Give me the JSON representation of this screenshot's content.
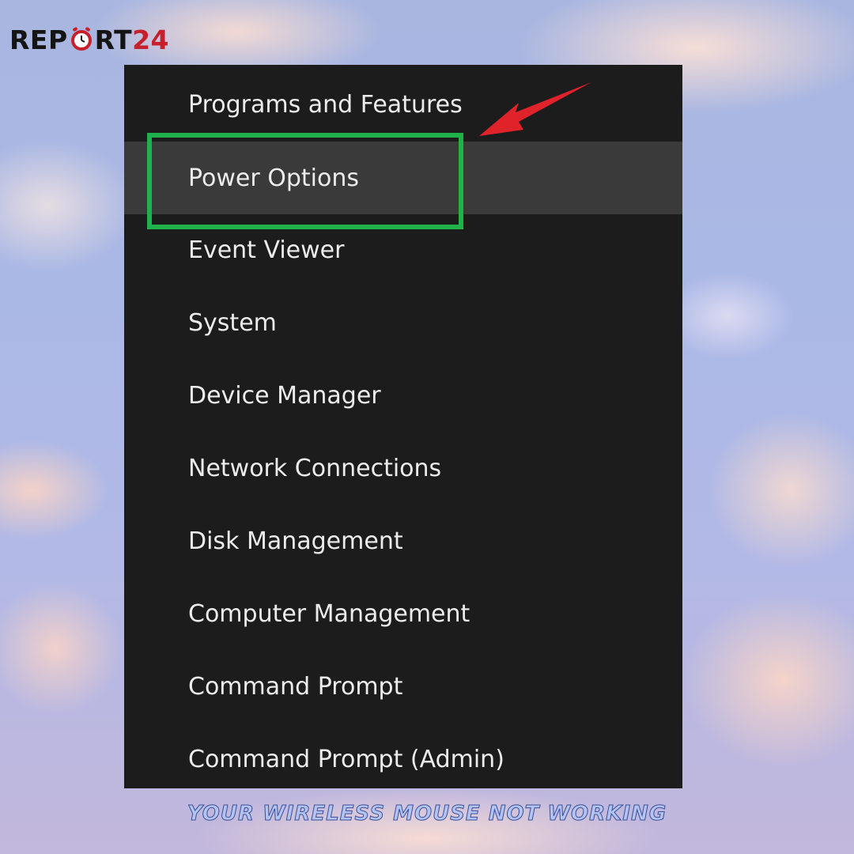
{
  "brand": {
    "logo_prefix": "REP",
    "logo_middle": "RT",
    "logo_suffix": "24",
    "logo_icon": "alarm-clock-icon",
    "colors": {
      "dark": "#141414",
      "red": "#c8202a"
    }
  },
  "context_menu": {
    "items": [
      {
        "label": "Programs and Features",
        "hovered": false,
        "highlighted": false
      },
      {
        "label": "Power Options",
        "hovered": true,
        "highlighted": true
      },
      {
        "label": "Event Viewer",
        "hovered": false,
        "highlighted": false
      },
      {
        "label": "System",
        "hovered": false,
        "highlighted": false
      },
      {
        "label": "Device Manager",
        "hovered": false,
        "highlighted": false
      },
      {
        "label": "Network Connections",
        "hovered": false,
        "highlighted": false
      },
      {
        "label": "Disk Management",
        "hovered": false,
        "highlighted": false
      },
      {
        "label": "Computer Management",
        "hovered": false,
        "highlighted": false
      },
      {
        "label": "Command Prompt",
        "hovered": false,
        "highlighted": false
      },
      {
        "label": "Command Prompt (Admin)",
        "hovered": false,
        "highlighted": false
      }
    ],
    "colors": {
      "background": "#1c1c1c",
      "hover": "#3a3a3a",
      "text": "#ececec",
      "highlight_border": "#1fb14a",
      "arrow": "#e0222a"
    }
  },
  "caption": {
    "text": "YOUR WIRELESS MOUSE NOT WORKING"
  }
}
